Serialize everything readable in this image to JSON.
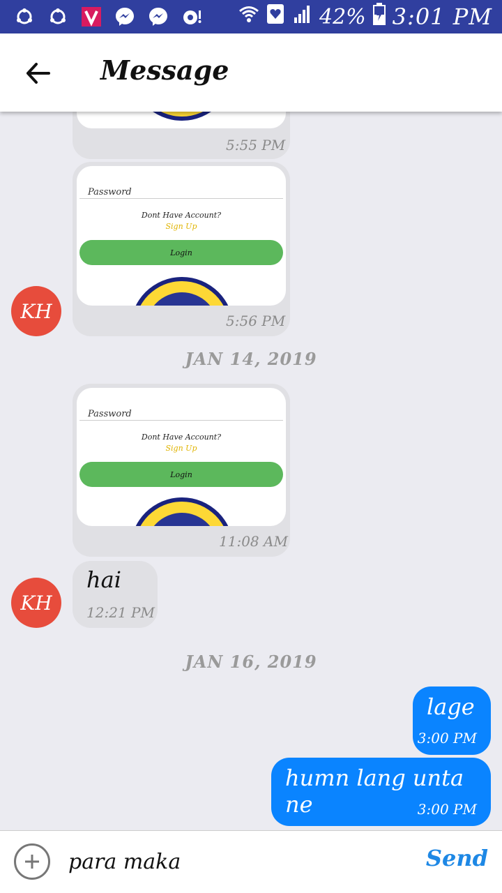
{
  "status_bar": {
    "battery": "42%",
    "time": "3:01 PM"
  },
  "header": {
    "title": "Message"
  },
  "contact_initials": "KH",
  "messages": {
    "m1_time": "5:55 PM",
    "m2": {
      "password_label": "Password",
      "no_account": "Dont Have Account?",
      "signup": "Sign Up",
      "login": "Login",
      "time": "5:56 PM"
    },
    "date1": "JAN 14, 2019",
    "m3": {
      "password_label": "Password",
      "no_account": "Dont Have Account?",
      "signup": "Sign Up",
      "login": "Login",
      "time": "11:08 AM"
    },
    "m4": {
      "text": "hai",
      "time": "12:21 PM"
    },
    "date2": "JAN 16, 2019",
    "m5": {
      "text": "lage",
      "time": "3:00 PM"
    },
    "m6": {
      "text": "humn lang unta ne",
      "time": "3:00 PM"
    }
  },
  "composer": {
    "value": "para maka",
    "send_label": "Send"
  },
  "colors": {
    "status_bar": "#303f9f",
    "outgoing_bubble": "#0a84ff",
    "incoming_bubble": "#e0e0e4",
    "avatar": "#e74c3c",
    "send": "#1e88e5",
    "login_button": "#5cb85c"
  }
}
